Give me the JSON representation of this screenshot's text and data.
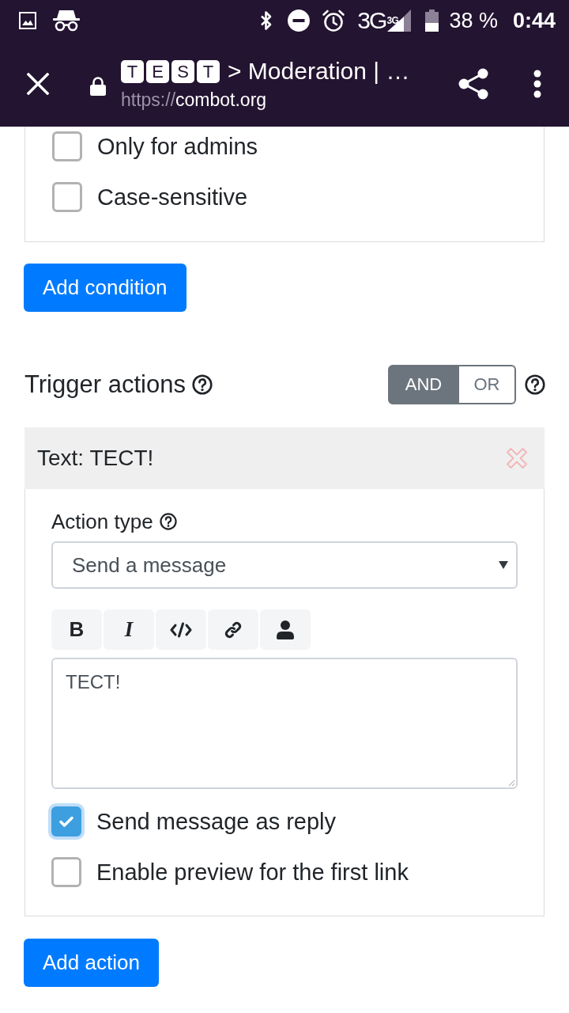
{
  "status_bar": {
    "network": "3G",
    "network_small": "3G",
    "battery": "38 %",
    "time": "0:44"
  },
  "browser_toolbar": {
    "title_letters": [
      "T",
      "E",
      "S",
      "T"
    ],
    "title": "> Moderation | …",
    "url_scheme": "https://",
    "url_host": "combot.org"
  },
  "conditions_card": {
    "options": [
      {
        "label": "Only for admins",
        "checked": false,
        "focused": false
      },
      {
        "label": "Case-sensitive",
        "checked": false,
        "focused": false
      }
    ]
  },
  "add_condition_button": "Add condition",
  "trigger_actions": {
    "title": "Trigger actions",
    "mode": [
      {
        "label": "AND",
        "selected": true
      },
      {
        "label": "OR",
        "selected": false
      }
    ]
  },
  "action_card": {
    "title": "Text: TECT!",
    "action_type_label": "Action type",
    "action_type": "Send a message",
    "format_buttons": [
      {
        "kind": "bold",
        "label": "B"
      },
      {
        "kind": "italic",
        "label": "I"
      },
      {
        "kind": "code"
      },
      {
        "kind": "link"
      },
      {
        "kind": "mention"
      }
    ],
    "message": "TECT!",
    "options": [
      {
        "label": "Send message as reply",
        "checked": true,
        "focused": true
      },
      {
        "label": "Enable preview for the first link",
        "checked": false,
        "focused": false
      }
    ]
  },
  "add_action_button": "Add action"
}
